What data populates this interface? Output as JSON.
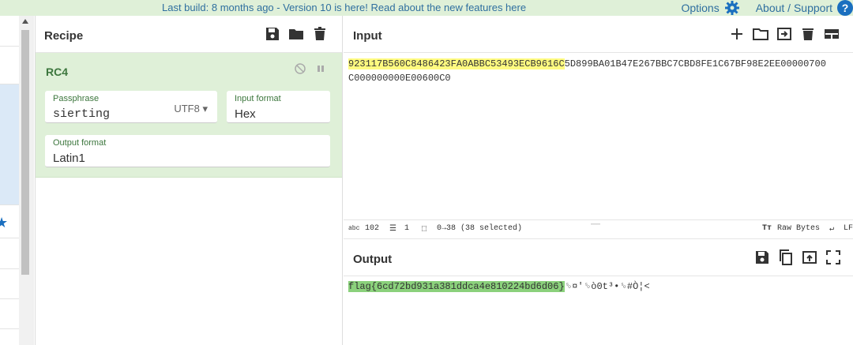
{
  "banner": {
    "text": "Last build: 8 months ago - Version 10 is here! Read about the new features here"
  },
  "topnav": {
    "options": "Options",
    "about": "About / Support",
    "help": "?"
  },
  "recipe": {
    "title": "Recipe",
    "operation": {
      "name": "RC4",
      "passphrase": {
        "label": "Passphrase",
        "value": "sierting",
        "encoding": "UTF8"
      },
      "input_format": {
        "label": "Input format",
        "value": "Hex"
      },
      "output_format": {
        "label": "Output format",
        "value": "Latin1"
      }
    }
  },
  "input": {
    "title": "Input",
    "selected_text": "923117B560C8486423FA0ABBC53493ECB9616C",
    "rest_line1": "5D899BA01B47E267BBC7CBD8FE1C67BF98E2EE00000700",
    "line2": "C000000000E00600C0"
  },
  "status": {
    "length_icon": "abc",
    "length": "102",
    "lines": "1",
    "selection": "0→38 (38 selected)",
    "raw": "Raw Bytes",
    "eol": "LF"
  },
  "output": {
    "title": "Output",
    "flag": "flag{6cd72bd931a381ddca4e810224bd6d06}",
    "rest": "␎¤'␎ò0t³•␎#Ò¦<"
  }
}
